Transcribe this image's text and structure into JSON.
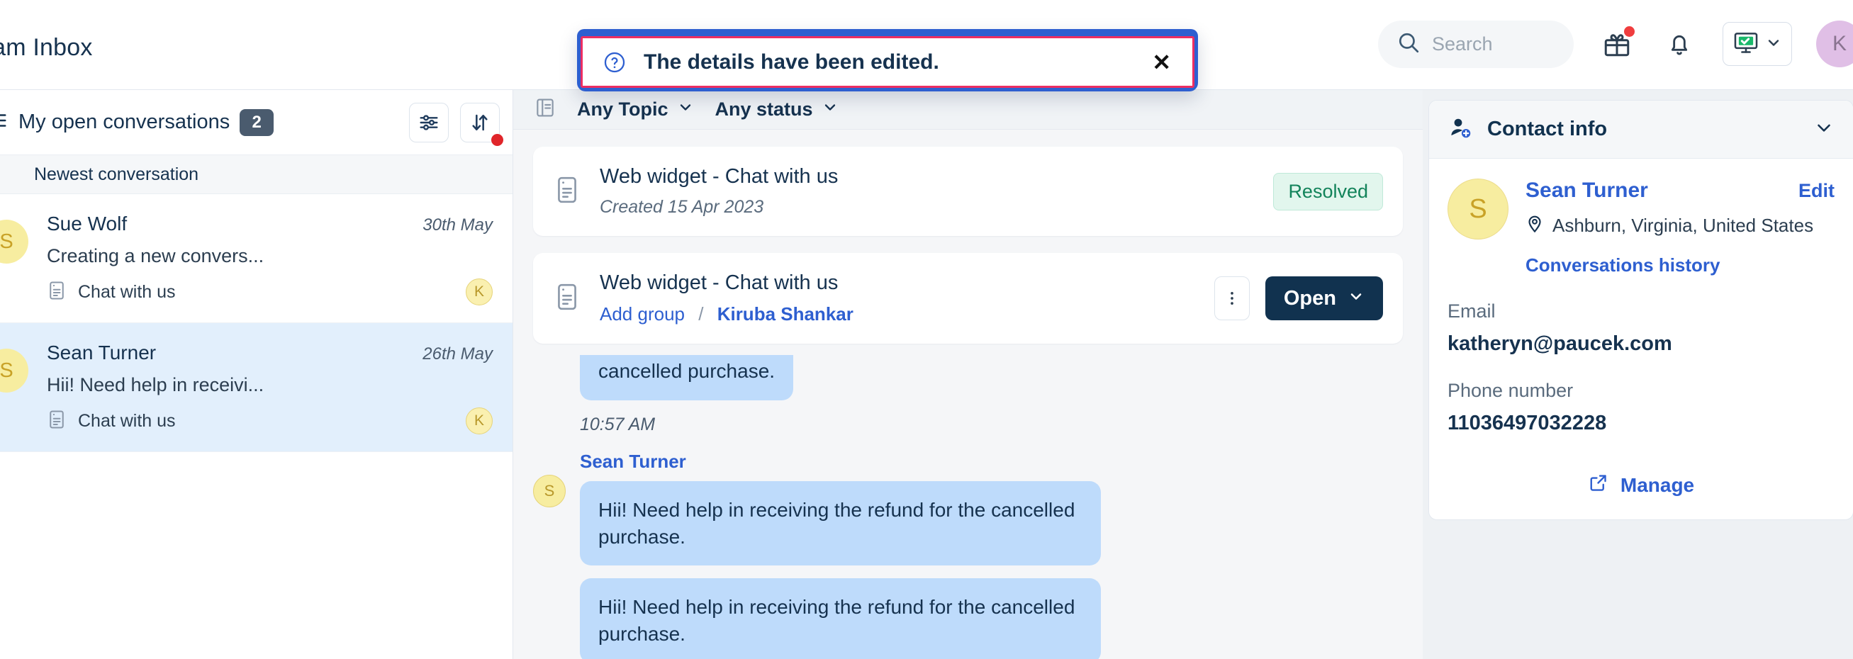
{
  "header": {
    "title": "eam Inbox",
    "search": {
      "placeholder": "Search",
      "icon": "search-icon"
    },
    "gift_icon": "gift-icon",
    "bell_icon": "bell-icon",
    "status_icon": "monitor-online-icon",
    "status_chevron": "chevron-down-icon",
    "avatar_initial": "K"
  },
  "toast": {
    "icon": "question-circle-icon",
    "message": "The details have been edited.",
    "close_label": "✕",
    "accent_bar_color": "#2e5fd0",
    "border_color": "#ec2e62"
  },
  "left_pane": {
    "menu_icon": "list-icon",
    "title": "My open conversations",
    "count": "2",
    "filter_icon": "sliders-icon",
    "sort_icon": "sort-arrows-icon",
    "sort_row_label": "Newest conversation",
    "conversations": [
      {
        "avatar_initial": "S",
        "name": "Sue Wolf",
        "date": "30th May",
        "snippet": "Creating a new convers...",
        "channel_icon": "widget-icon",
        "channel": "Chat with us",
        "assignee_initial": "K",
        "selected": false
      },
      {
        "avatar_initial": "S",
        "name": "Sean Turner",
        "date": "26th May",
        "snippet": "Hii! Need help in receivi...",
        "channel_icon": "widget-icon",
        "channel": "Chat with us",
        "assignee_initial": "K",
        "selected": true
      }
    ]
  },
  "center_pane": {
    "filters": {
      "topic_icon": "book-icon",
      "topic": "Any Topic",
      "status": "Any status",
      "chevron": "chevron-down-icon"
    },
    "cards": [
      {
        "icon": "widget-icon",
        "title": "Web widget - Chat with us",
        "subtitle": "Created 15 Apr 2023",
        "status_badge": "Resolved"
      },
      {
        "icon": "widget-icon",
        "title": "Web widget - Chat with us",
        "link_add_group": "Add group",
        "link_separator": "/",
        "link_agent": "Kiruba Shankar",
        "kebab_icon": "kebab-menu-icon",
        "open_button": "Open",
        "open_chevron": "chevron-down-icon"
      }
    ],
    "thread": {
      "clipped_bubble_text": "cancelled purchase.",
      "time": "10:57 AM",
      "sender": "Sean Turner",
      "sender_avatar_initial": "S",
      "messages": [
        "Hii! Need help in receiving the refund for the cancelled purchase.",
        "Hii! Need help in receiving the refund for the cancelled purchase."
      ]
    }
  },
  "right_pane": {
    "header_icon": "contact-add-icon",
    "header_title": "Contact info",
    "header_chevron": "chevron-down-icon",
    "avatar_initial": "S",
    "name": "Sean Turner",
    "edit_label": "Edit",
    "location_icon": "map-pin-icon",
    "location": "Ashburn, Virginia, United States",
    "history_link": "Conversations history",
    "fields": [
      {
        "label": "Email",
        "value": "katheryn@paucek.com"
      },
      {
        "label": "Phone number",
        "value": "11036497032228"
      }
    ],
    "manage_icon": "external-link-icon",
    "manage_label": "Manage"
  }
}
